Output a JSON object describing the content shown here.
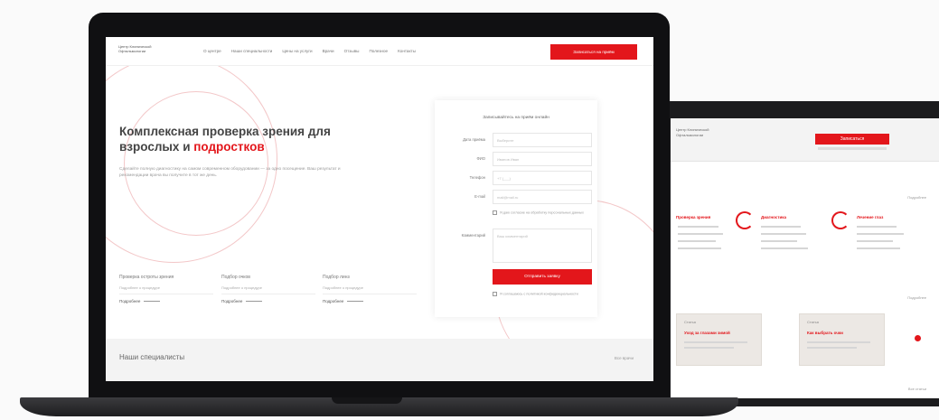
{
  "laptop": {
    "logo": "Центр Клинической Офтальмологии",
    "nav": [
      "О центре",
      "Наши специальности",
      "Цены на услуги",
      "Врачи",
      "Отзывы",
      "Полезное",
      "Контакты"
    ],
    "nav_cta": "Записаться на приём",
    "hero": {
      "title": "Комплексная проверка зрения для взрослых и",
      "title_highlight": "подростков",
      "text": "Сделайте полную диагностику на самом современном оборудовании — за одно посещение. Ваш результат и рекомендации врача вы получите в тот же день."
    },
    "features": [
      {
        "title": "Проверка остроты зрения",
        "text": "Подробнее о процедуре",
        "more": "Подробнее"
      },
      {
        "title": "Подбор очков",
        "text": "Подробнее о процедуре",
        "more": "Подробнее"
      },
      {
        "title": "Подбор линз",
        "text": "Подробнее о процедуре",
        "more": "Подробнее"
      }
    ],
    "form": {
      "title": "Записывайтесь на приём онлайн",
      "fields": [
        {
          "label": "Дата приёма",
          "placeholder": "Выберите"
        },
        {
          "label": "ФИО",
          "placeholder": "Иванов Иван"
        },
        {
          "label": "Телефон",
          "placeholder": "+7 (___)"
        },
        {
          "label": "E-mail",
          "placeholder": "mail@mail.ru"
        }
      ],
      "consent": "Я даю согласие на обработку персональных данных",
      "comment_label": "Комментарий",
      "comment_placeholder": "Ваш комментарий",
      "submit": "Отправить заявку",
      "consent2": "Я соглашаюсь с политикой конфиденциальности"
    },
    "band": {
      "title": "Наши специалисты",
      "link": "Все врачи"
    }
  },
  "tablet": {
    "brand": "Центр Клинической Офтальмологии",
    "cta": "Записаться",
    "link1": "Подробнее",
    "cards": [
      {
        "title": "Проверка зрения"
      },
      {
        "title": "Диагностика"
      },
      {
        "title": "Лечение глаз"
      }
    ],
    "link2": "Подробнее",
    "posts": [
      {
        "tag": "Статья",
        "title": "Уход за глазами зимой"
      },
      {
        "tag": "Статья",
        "title": "Как выбрать очки"
      }
    ],
    "link3": "Все статьи"
  },
  "colors": {
    "accent": "#e3161b",
    "device": "#101012"
  }
}
